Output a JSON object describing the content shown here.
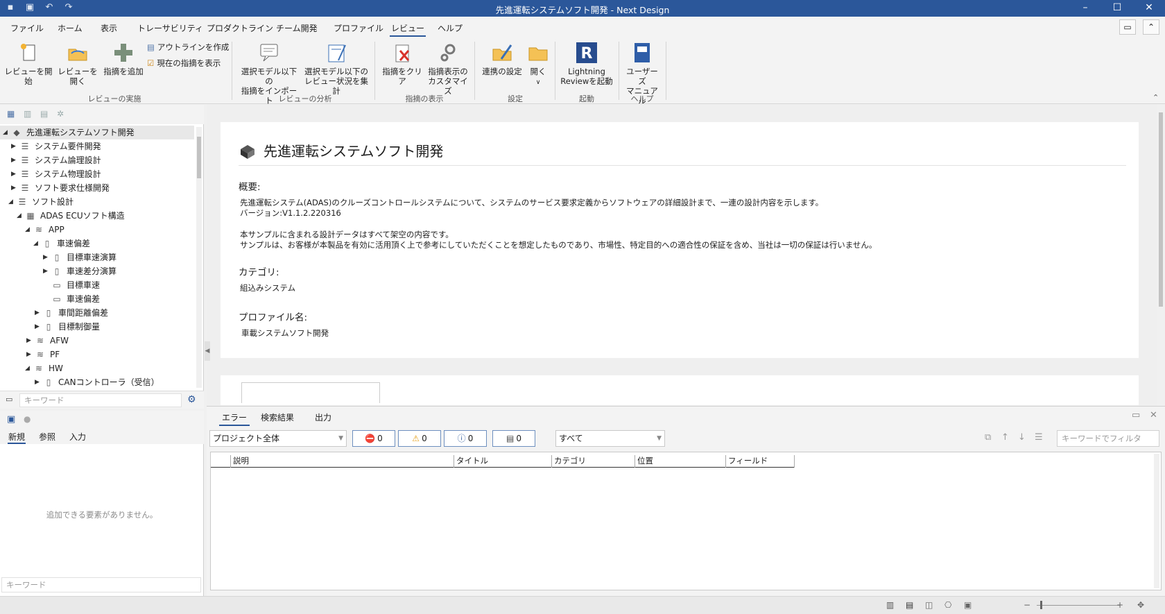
{
  "window": {
    "title": "先進運転システムソフト開発 - Next Design"
  },
  "menu": {
    "tabs": [
      "ファイル",
      "ホーム",
      "表示",
      "トレーサビリティ",
      "プロダクトライン",
      "チーム開発",
      "プロファイル",
      "レビュー",
      "ヘルプ"
    ],
    "active": "レビュー"
  },
  "ribbon": {
    "start_review": "レビューを開始",
    "open_review": "レビューを開く",
    "add_comment": "指摘を追加",
    "create_outline": "アウトラインを作成",
    "show_current": "現在の指摘を表示",
    "group_review": "レビューの実施",
    "import_line1": "選択モデル以下の",
    "import_line2": "指摘をインポート",
    "aggregate_line1": "選択モデル以下の",
    "aggregate_line2": "レビュー状況を集計",
    "group_analysis": "レビューの分析",
    "clear": "指摘をクリア",
    "customize_line1": "指摘表示の",
    "customize_line2": "カスタマイズ",
    "group_display": "指摘の表示",
    "link_settings": "連携の設定",
    "open": "開く",
    "group_settings": "設定",
    "lightning_line1": "Lightning",
    "lightning_line2": "Reviewを起動",
    "group_launch": "起動",
    "manual_line1": "ユーザーズ",
    "manual_line2": "マニュアル",
    "group_help": "ヘルプ"
  },
  "tree": {
    "nodes": [
      "先進運転システムソフト開発",
      "システム要件開発",
      "システム論理設計",
      "システム物理設計",
      "ソフト要求仕様開発",
      "ソフト設計",
      "ADAS ECUソフト構造",
      "APP",
      "車速偏差",
      "目標車速演算",
      "車速差分演算",
      "目標車速",
      "車速偏差",
      "車間距離偏差",
      "目標制御量",
      "AFW",
      "PF",
      "HW",
      "CANコントローラ（受信）"
    ],
    "keyword_placeholder": "キーワード"
  },
  "left_bottom": {
    "tabs": [
      "新規",
      "参照",
      "入力"
    ],
    "empty_message": "追加できる要素がありません。",
    "keyword_placeholder": "キーワード"
  },
  "document": {
    "title": "先進運転システムソフト開発",
    "overview_label": "概要:",
    "overview_line1": "先進運転システム(ADAS)のクルーズコントロールシステムについて、システムのサービス要求定義からソフトウェアの詳細設計まで、一連の設計内容を示します。",
    "overview_line2": "バージョン:V1.1.2.220316",
    "overview_line3": "本サンプルに含まれる設計データはすべて架空の内容です。",
    "overview_line4": "サンプルは、お客様が本製品を有効に活用頂く上で参考にしていただくことを想定したものであり、市場性、特定目的への適合性の保証を含め、当社は一切の保証は行いません。",
    "category_label": "カテゴリ:",
    "category_value": "組込みシステム",
    "profile_label": "プロファイル名:",
    "profile_value": "車載システムソフト開発"
  },
  "error_panel": {
    "tabs": [
      "エラー",
      "検索結果",
      "出力"
    ],
    "scope": "プロジェクト全体",
    "counts": {
      "error": "0",
      "warning": "0",
      "info": "0",
      "message": "0"
    },
    "level": "すべて",
    "filter_placeholder": "キーワードでフィルタ",
    "columns": [
      "説明",
      "タイトル",
      "カテゴリ",
      "位置",
      "フィールド"
    ]
  }
}
